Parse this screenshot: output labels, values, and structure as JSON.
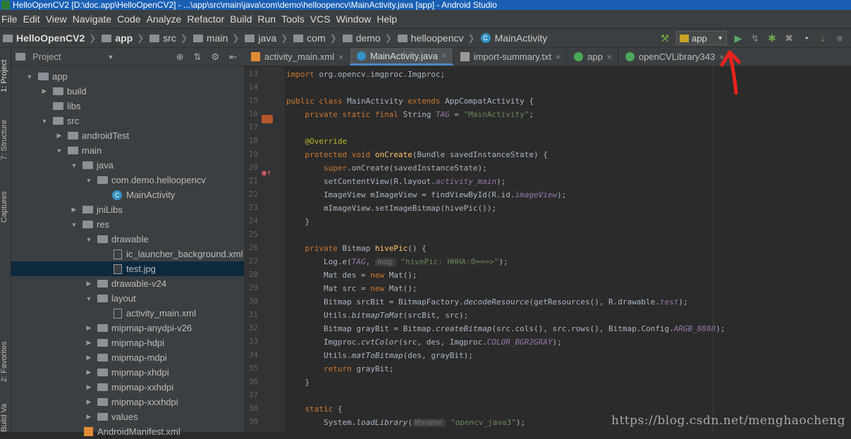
{
  "window": {
    "title": "HelloOpenCV2 [D:\\doc.app\\HelloOpenCV2] - ...\\app\\src\\main\\java\\com\\demo\\helloopencv\\MainActivity.java [app] - Android Studio"
  },
  "menu": [
    "File",
    "Edit",
    "View",
    "Navigate",
    "Code",
    "Analyze",
    "Refactor",
    "Build",
    "Run",
    "Tools",
    "VCS",
    "Window",
    "Help"
  ],
  "breadcrumbs": [
    "HelloOpenCV2",
    "app",
    "src",
    "main",
    "java",
    "com",
    "demo",
    "helloopencv",
    "MainActivity"
  ],
  "run_config": "app",
  "left_tabs": [
    "1: Project",
    "7: Structure",
    "Captures",
    "2: Favorites",
    "Build Variants"
  ],
  "project_panel": {
    "title": "Project"
  },
  "tree": [
    {
      "label": "app",
      "depth": 0,
      "arrow": "down",
      "icon": "folder"
    },
    {
      "label": "build",
      "depth": 1,
      "arrow": "right",
      "icon": "folder"
    },
    {
      "label": "libs",
      "depth": 1,
      "arrow": "",
      "icon": "folder"
    },
    {
      "label": "src",
      "depth": 1,
      "arrow": "down",
      "icon": "folder"
    },
    {
      "label": "androidTest",
      "depth": 2,
      "arrow": "right",
      "icon": "folder"
    },
    {
      "label": "main",
      "depth": 2,
      "arrow": "down",
      "icon": "folder"
    },
    {
      "label": "java",
      "depth": 3,
      "arrow": "down",
      "icon": "folder"
    },
    {
      "label": "com.demo.helloopencv",
      "depth": 4,
      "arrow": "down",
      "icon": "folder"
    },
    {
      "label": "MainActivity",
      "depth": 5,
      "arrow": "",
      "icon": "class"
    },
    {
      "label": "jniLibs",
      "depth": 3,
      "arrow": "right",
      "icon": "folder"
    },
    {
      "label": "res",
      "depth": 3,
      "arrow": "down",
      "icon": "folder"
    },
    {
      "label": "drawable",
      "depth": 4,
      "arrow": "down",
      "icon": "folder"
    },
    {
      "label": "ic_launcher_background.xml",
      "depth": 5,
      "arrow": "",
      "icon": "file"
    },
    {
      "label": "test.jpg",
      "depth": 5,
      "arrow": "",
      "icon": "file",
      "selected": true
    },
    {
      "label": "drawable-v24",
      "depth": 4,
      "arrow": "right",
      "icon": "folder"
    },
    {
      "label": "layout",
      "depth": 4,
      "arrow": "down",
      "icon": "folder"
    },
    {
      "label": "activity_main.xml",
      "depth": 5,
      "arrow": "",
      "icon": "file"
    },
    {
      "label": "mipmap-anydpi-v26",
      "depth": 4,
      "arrow": "right",
      "icon": "folder"
    },
    {
      "label": "mipmap-hdpi",
      "depth": 4,
      "arrow": "right",
      "icon": "folder"
    },
    {
      "label": "mipmap-mdpi",
      "depth": 4,
      "arrow": "right",
      "icon": "folder"
    },
    {
      "label": "mipmap-xhdpi",
      "depth": 4,
      "arrow": "right",
      "icon": "folder"
    },
    {
      "label": "mipmap-xxhdpi",
      "depth": 4,
      "arrow": "right",
      "icon": "folder"
    },
    {
      "label": "mipmap-xxxhdpi",
      "depth": 4,
      "arrow": "right",
      "icon": "folder"
    },
    {
      "label": "values",
      "depth": 4,
      "arrow": "right",
      "icon": "folder"
    },
    {
      "label": "AndroidManifest.xml",
      "depth": 3,
      "arrow": "",
      "icon": "xml"
    }
  ],
  "editor_tabs": [
    {
      "label": "activity_main.xml",
      "icon": "xml",
      "active": false
    },
    {
      "label": "MainActivity.java",
      "icon": "class",
      "active": true
    },
    {
      "label": "import-summary.txt",
      "icon": "text",
      "active": false
    },
    {
      "label": "app",
      "icon": "gradle",
      "active": false
    },
    {
      "label": "openCVLibrary343",
      "icon": "gradle",
      "active": false
    }
  ],
  "line_numbers": [
    "13",
    "14",
    "15",
    "16",
    "17",
    "18",
    "19",
    "20",
    "21",
    "22",
    "23",
    "24",
    "25",
    "26",
    "27",
    "28",
    "29",
    "30",
    "31",
    "32",
    "33",
    "34",
    "35",
    "36",
    "37",
    "38",
    "39"
  ],
  "code_lines": [
    [
      [
        "kw",
        "import "
      ],
      [
        "",
        "org.opencv.imgproc.Imgproc;"
      ]
    ],
    [],
    [
      [
        "kw",
        "public class "
      ],
      [
        "",
        "MainActivity "
      ],
      [
        "kw",
        "extends "
      ],
      [
        "",
        "AppCompatActivity {"
      ]
    ],
    [
      [
        "",
        "    "
      ],
      [
        "kw",
        "private static final "
      ],
      [
        "",
        "String "
      ],
      [
        "it",
        "TAG"
      ],
      [
        "",
        " = "
      ],
      [
        "str",
        "\"MainActivity\""
      ],
      [
        "",
        ";"
      ]
    ],
    [],
    [
      [
        "",
        "    "
      ],
      [
        "ann",
        "@Override"
      ]
    ],
    [
      [
        "",
        "    "
      ],
      [
        "kw",
        "protected void "
      ],
      [
        "fn",
        "onCreate"
      ],
      [
        "",
        "(Bundle savedInstanceState) {"
      ]
    ],
    [
      [
        "",
        "        "
      ],
      [
        "kw",
        "super"
      ],
      [
        "",
        ".onCreate(savedInstanceState);"
      ]
    ],
    [
      [
        "",
        "        setContentView(R.layout."
      ],
      [
        "it",
        "activity_main"
      ],
      [
        "",
        ");"
      ]
    ],
    [
      [
        "",
        "        ImageView mImageView = findViewById(R.id."
      ],
      [
        "it",
        "imageView"
      ],
      [
        "",
        ");"
      ]
    ],
    [
      [
        "",
        "        mImageView.setImageBitmap(hivePic());"
      ]
    ],
    [
      [
        "",
        "    }"
      ]
    ],
    [],
    [
      [
        "",
        "    "
      ],
      [
        "kw",
        "private "
      ],
      [
        "",
        "Bitmap "
      ],
      [
        "fn",
        "hivePic"
      ],
      [
        "",
        "() {"
      ]
    ],
    [
      [
        "",
        "        Log."
      ],
      [
        "st",
        "e"
      ],
      [
        "",
        "("
      ],
      [
        "it",
        "TAG"
      ],
      [
        "",
        ", "
      ],
      [
        "hint",
        "msg:"
      ],
      [
        "",
        " "
      ],
      [
        "str",
        "\"hivePic: HHHA:0===>\""
      ],
      [
        "",
        ");"
      ]
    ],
    [
      [
        "",
        "        Mat des = "
      ],
      [
        "kw",
        "new "
      ],
      [
        "",
        "Mat();"
      ]
    ],
    [
      [
        "",
        "        Mat src = "
      ],
      [
        "kw",
        "new "
      ],
      [
        "",
        "Mat();"
      ]
    ],
    [
      [
        "",
        "        Bitmap srcBit = BitmapFactory."
      ],
      [
        "st",
        "decodeResource"
      ],
      [
        "",
        "(getResources(), R.drawable."
      ],
      [
        "it",
        "test"
      ],
      [
        "",
        ");"
      ]
    ],
    [
      [
        "",
        "        Utils."
      ],
      [
        "st",
        "bitmapToMat"
      ],
      [
        "",
        "(srcBit, src);"
      ]
    ],
    [
      [
        "",
        "        Bitmap grayBit = Bitmap."
      ],
      [
        "st",
        "createBitmap"
      ],
      [
        "",
        "(src.cols(), src.rows(), Bitmap.Config."
      ],
      [
        "it",
        "ARGB_8888"
      ],
      [
        "",
        ");"
      ]
    ],
    [
      [
        "",
        "        Imgproc."
      ],
      [
        "st",
        "cvtColor"
      ],
      [
        "",
        "(src, des, Imgproc."
      ],
      [
        "it",
        "COLOR_BGR2GRAY"
      ],
      [
        "",
        ");"
      ]
    ],
    [
      [
        "",
        "        Utils."
      ],
      [
        "st",
        "matToBitmap"
      ],
      [
        "",
        "(des, grayBit);"
      ]
    ],
    [
      [
        "",
        "        "
      ],
      [
        "kw",
        "return "
      ],
      [
        "",
        "grayBit;"
      ]
    ],
    [
      [
        "",
        "    }"
      ]
    ],
    [],
    [
      [
        "",
        "    "
      ],
      [
        "kw",
        "static "
      ],
      [
        "",
        "{"
      ]
    ],
    [
      [
        "",
        "        System."
      ],
      [
        "st",
        "loadLibrary"
      ],
      [
        "",
        "("
      ],
      [
        "hint",
        "libname:"
      ],
      [
        "",
        " "
      ],
      [
        "str",
        "\"opencv_java3\""
      ],
      [
        "",
        ");"
      ]
    ]
  ],
  "watermark": "https://blog.csdn.net/menghaocheng",
  "colors": {
    "accent": "#4a88c7",
    "run_green": "#59a869",
    "annotation_red": "#e8231c"
  }
}
